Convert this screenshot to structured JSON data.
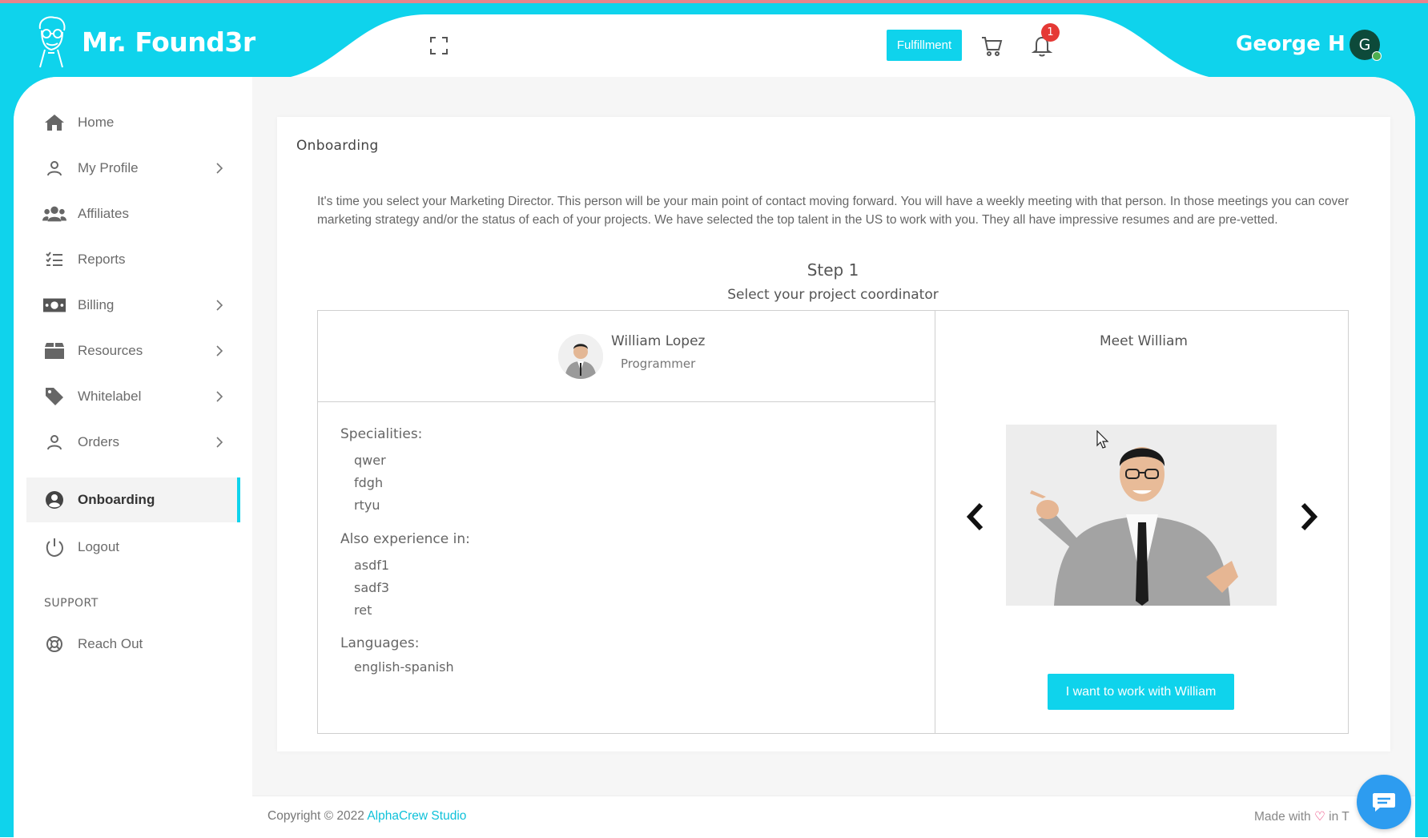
{
  "brand": {
    "name": "Mr. Found3r"
  },
  "header": {
    "fulfillment_label": "Fulfillment",
    "notification_count": "1",
    "user_name": "George H",
    "avatar_initial": "G"
  },
  "sidebar": {
    "items": [
      {
        "label": "Home",
        "icon": "home-icon",
        "has_chevron": false
      },
      {
        "label": "My Profile",
        "icon": "user-icon",
        "has_chevron": true
      },
      {
        "label": "Affiliates",
        "icon": "users-icon",
        "has_chevron": false
      },
      {
        "label": "Reports",
        "icon": "list-icon",
        "has_chevron": false
      },
      {
        "label": "Billing",
        "icon": "money-icon",
        "has_chevron": true
      },
      {
        "label": "Resources",
        "icon": "box-icon",
        "has_chevron": true
      },
      {
        "label": "Whitelabel",
        "icon": "tag-icon",
        "has_chevron": true
      },
      {
        "label": "Orders",
        "icon": "user-icon",
        "has_chevron": true
      },
      {
        "label": "Onboarding",
        "icon": "user-circle-icon",
        "has_chevron": false,
        "active": true
      },
      {
        "label": "Logout",
        "icon": "power-icon",
        "has_chevron": false
      }
    ],
    "support_heading": "SUPPORT",
    "support_items": [
      {
        "label": "Reach Out",
        "icon": "lifebuoy-icon"
      }
    ]
  },
  "main": {
    "title": "Onboarding",
    "intro": "It's time you select your Marketing Director. This person will be your main point of contact moving forward. You will have a weekly meeting with that person. In those meetings you can cover marketing strategy and/or the status of each of your projects. We have selected the top talent in the US to work with you. They all have impressive resumes and are pre-vetted.",
    "step": "Step 1",
    "step_subtitle": "Select your project coordinator",
    "person": {
      "name": "William Lopez",
      "role": "Programmer",
      "specialities_label": "Specialities:",
      "specialities": [
        "qwer",
        "fdgh",
        "rtyu"
      ],
      "experience_label": "Also experience in:",
      "experience": [
        "asdf1",
        "sadf3",
        "ret"
      ],
      "languages_label": "Languages:",
      "languages": [
        "english-spanish"
      ]
    },
    "meet_label": "Meet William",
    "work_button": "I want to work with William"
  },
  "footer": {
    "copyright": "Copyright © 2022 ",
    "studio": "AlphaCrew Studio",
    "made_with": "Made with ",
    "heart": "♡",
    "made_in": " in T"
  },
  "colors": {
    "accent": "#0fd3ec",
    "badge": "#e53935",
    "link": "#0fc1d9",
    "chat": "#2d9cf0"
  }
}
